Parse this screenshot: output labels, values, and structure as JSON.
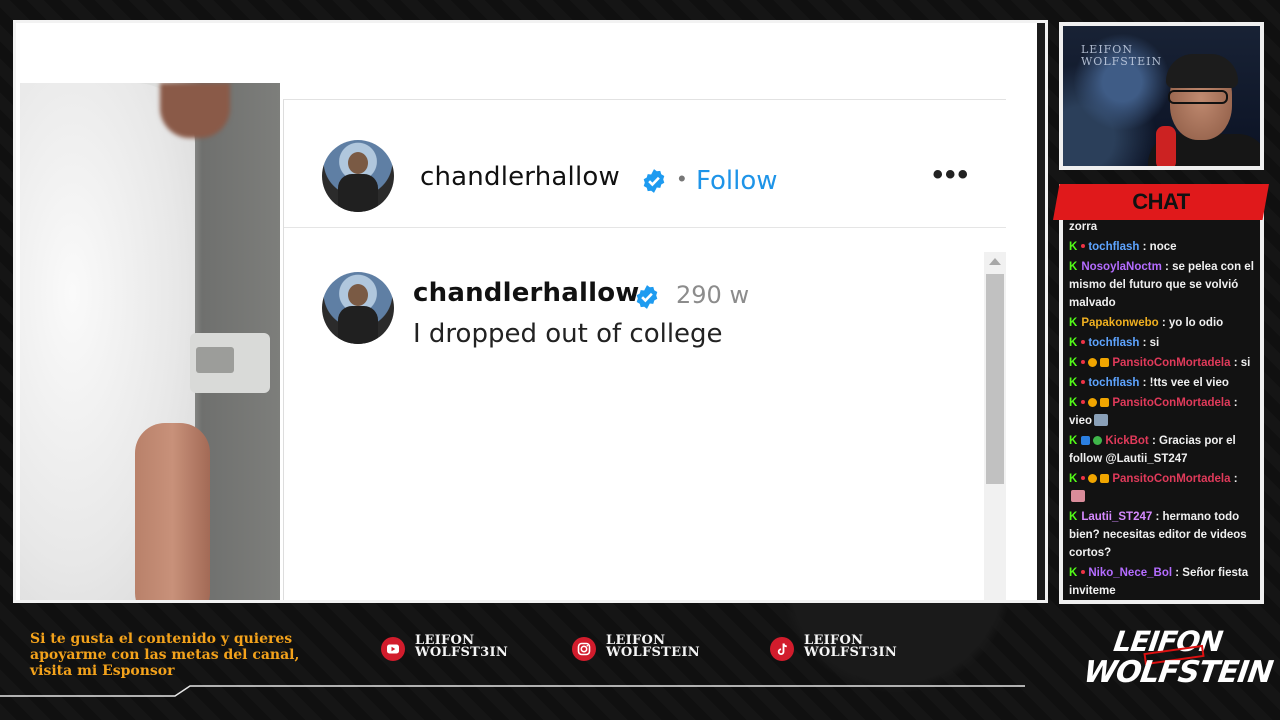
{
  "post": {
    "username": "chandlerhallow",
    "follow_label": "Follow",
    "separator": "•",
    "more_label": "•••",
    "comment": {
      "username": "chandlerhallow",
      "time": "290 w",
      "text": "I dropped out of college"
    }
  },
  "webcam": {
    "overlay_text_line1": "LEIFON",
    "overlay_text_line2": "WOLFSTEIN"
  },
  "chat": {
    "title": "CHAT",
    "messages": [
      {
        "user": "",
        "text": "zorra",
        "user_color": "#ffffff"
      },
      {
        "user": "tochflash",
        "text": ": noce",
        "user_color": "#5ea4ff"
      },
      {
        "user": "NosoylaNoctm",
        "text": ": se pelea con el mismo del futuro que se volvió malvado",
        "user_color": "#b46cff"
      },
      {
        "user": "Papakonwebo",
        "text": ": yo lo odio",
        "user_color": "#f0b020"
      },
      {
        "user": "tochflash",
        "text": ": si",
        "user_color": "#5ea4ff"
      },
      {
        "user": "PansitoConMortadela",
        "text": ": si",
        "user_color": "#e03a5a"
      },
      {
        "user": "tochflash",
        "text": ": !tts vee el vieo",
        "user_color": "#5ea4ff"
      },
      {
        "user": "PansitoConMortadela",
        "text": ": vieo",
        "user_color": "#e03a5a"
      },
      {
        "user": "KickBot",
        "text": ": Gracias por el follow @Lautii_ST247",
        "user_color": "#e03a5a"
      },
      {
        "user": "PansitoConMortadela",
        "text": ":",
        "user_color": "#e03a5a"
      },
      {
        "user": "Lautii_ST247",
        "text": ": hermano todo bien? necesitas editor de videos cortos?",
        "user_color": "#d68aff"
      },
      {
        "user": "Niko_Nece_Bol",
        "text": ": Señor fiesta inviteme",
        "user_color": "#b46cff"
      }
    ]
  },
  "footer": {
    "sponsor_text": "Si te gusta el contenido y quieres apoyarme con las metas del canal, visita mi Esponsor",
    "socials": [
      {
        "icon": "youtube-icon",
        "line1": "LEIFON",
        "line2": "WOLFST3IN"
      },
      {
        "icon": "instagram-icon",
        "line1": "LEIFON",
        "line2": "WOLFSTEIN"
      },
      {
        "icon": "tiktok-icon",
        "line1": "LEIFON",
        "line2": "WOLFST3IN"
      }
    ],
    "logo_top": "LEIFON",
    "logo_bottom": "WOLFSTEIN"
  },
  "colors": {
    "accent_red": "#e0191b",
    "sponsor_orange": "#f3a21b",
    "follow_blue": "#1e94e8",
    "verified_blue": "#1e9bf0",
    "kick_green": "#53fc18"
  }
}
